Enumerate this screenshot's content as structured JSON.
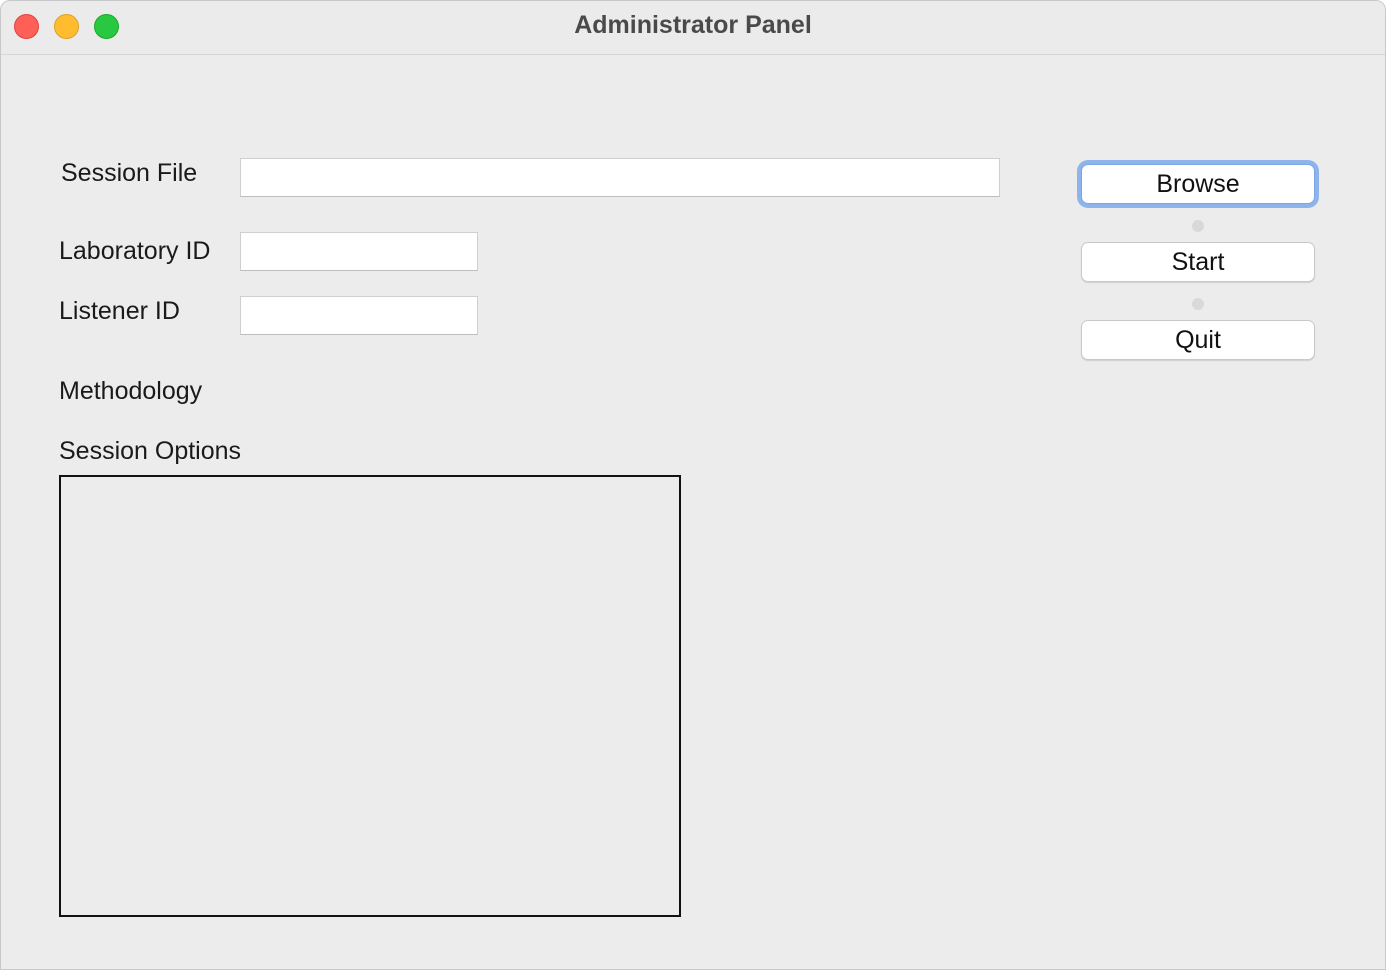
{
  "window": {
    "title": "Administrator Panel",
    "controls": {
      "close": "close-icon",
      "minimize": "minimize-icon",
      "maximize": "maximize-icon"
    }
  },
  "form": {
    "session_file": {
      "label": "Session File",
      "value": ""
    },
    "laboratory_id": {
      "label": "Laboratory ID",
      "value": ""
    },
    "listener_id": {
      "label": "Listener ID",
      "value": ""
    },
    "methodology": {
      "label": "Methodology"
    },
    "session_options": {
      "label": "Session Options"
    }
  },
  "buttons": {
    "browse": "Browse",
    "start": "Start",
    "quit": "Quit"
  },
  "colors": {
    "focus_ring": "#8fb4ec",
    "close": "#fe5f57",
    "minimize": "#febc2e",
    "maximize": "#28c840"
  }
}
